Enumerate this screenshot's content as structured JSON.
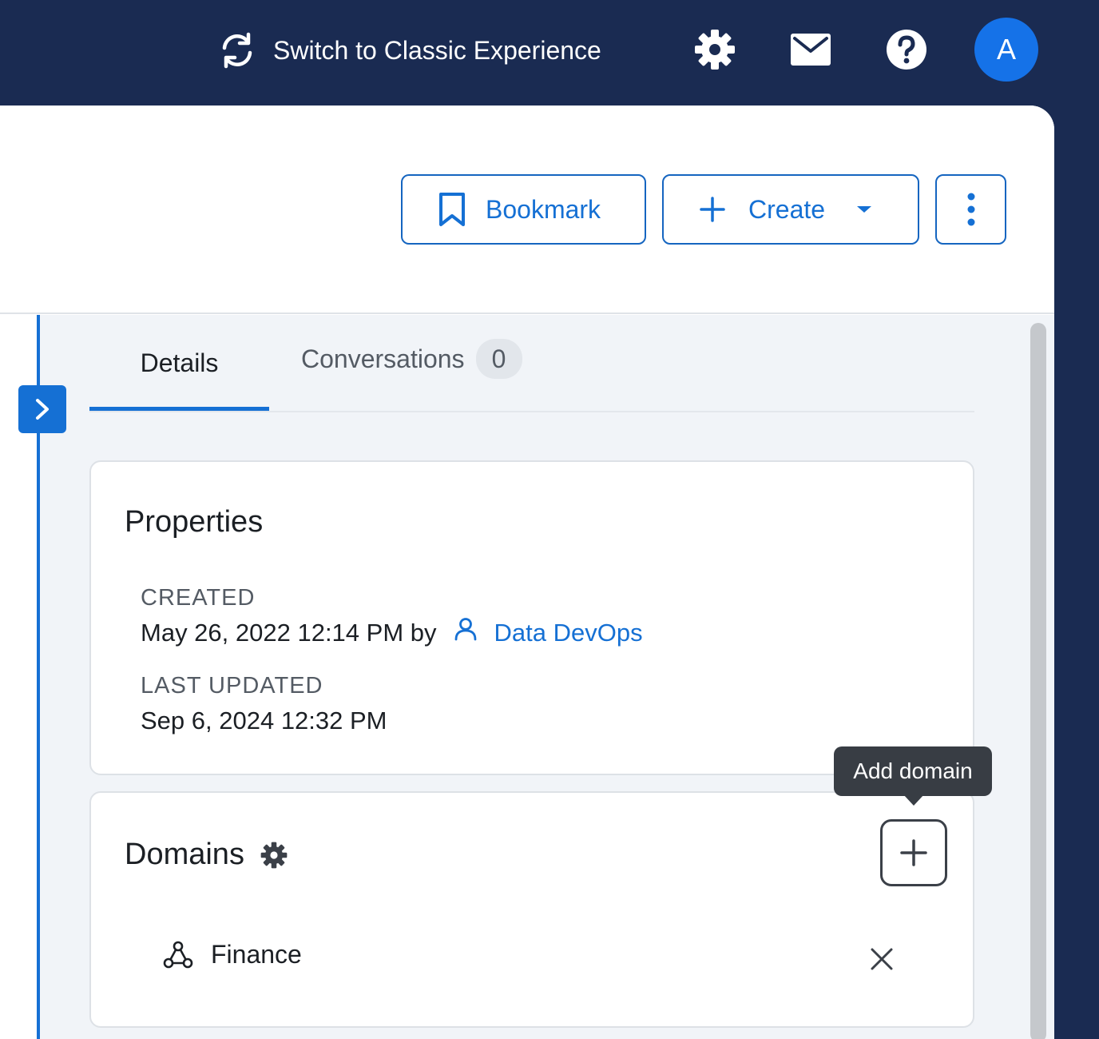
{
  "topbar": {
    "switch_label": "Switch to Classic Experience",
    "avatar_initial": "A",
    "brand_bg": "#1a2b52",
    "accent": "#1570d4"
  },
  "toolbar": {
    "bookmark_label": "Bookmark",
    "create_label": "Create"
  },
  "tabs": {
    "details_label": "Details",
    "conversations_label": "Conversations",
    "conversations_count": "0"
  },
  "properties": {
    "title": "Properties",
    "created_label": "CREATED",
    "created_value": "May 26, 2022 12:14 PM by",
    "created_by": "Data DevOps",
    "updated_label": "LAST UPDATED",
    "updated_value": "Sep 6, 2024 12:32 PM"
  },
  "domains": {
    "title": "Domains",
    "tooltip": "Add domain",
    "items": [
      {
        "label": "Finance"
      }
    ]
  },
  "icons": [
    "sync-icon",
    "gear-icon",
    "mail-icon",
    "help-icon",
    "bookmark-icon",
    "plus-icon",
    "caret-down-icon",
    "more-vertical-icon",
    "chevron-right-icon",
    "user-icon",
    "domain-icon",
    "close-icon"
  ]
}
